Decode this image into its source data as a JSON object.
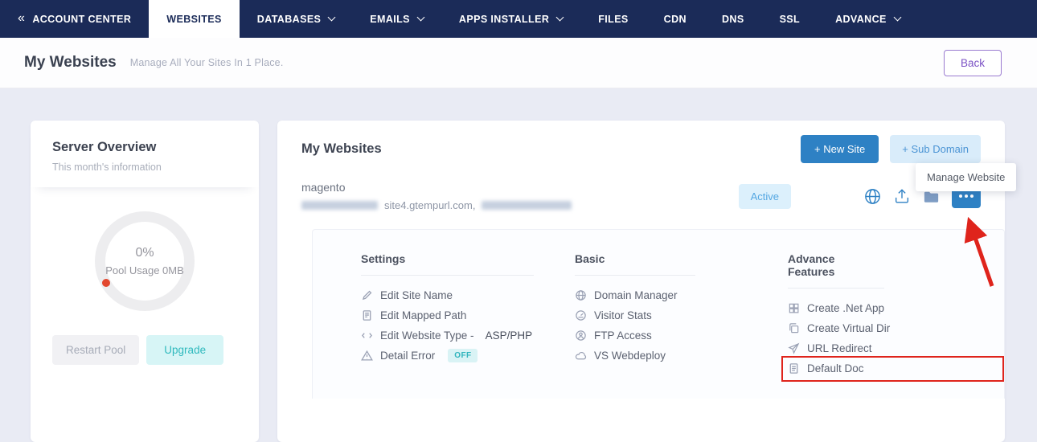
{
  "nav": {
    "back_icon": "«",
    "items": [
      {
        "label": "ACCOUNT CENTER",
        "dropdown": false,
        "active": false
      },
      {
        "label": "WEBSITES",
        "dropdown": false,
        "active": true
      },
      {
        "label": "DATABASES",
        "dropdown": true,
        "active": false
      },
      {
        "label": "EMAILS",
        "dropdown": true,
        "active": false
      },
      {
        "label": "APPS INSTALLER",
        "dropdown": true,
        "active": false
      },
      {
        "label": "FILES",
        "dropdown": false,
        "active": false
      },
      {
        "label": "CDN",
        "dropdown": false,
        "active": false
      },
      {
        "label": "DNS",
        "dropdown": false,
        "active": false
      },
      {
        "label": "SSL",
        "dropdown": false,
        "active": false
      },
      {
        "label": "ADVANCE",
        "dropdown": true,
        "active": false
      }
    ]
  },
  "header": {
    "title": "My Websites",
    "subtitle": "Manage All Your Sites In 1 Place.",
    "back_button": "Back"
  },
  "server_overview": {
    "title": "Server Overview",
    "subtitle": "This month's information",
    "gauge_value": "0%",
    "gauge_label": "Pool Usage 0MB",
    "restart_button": "Restart Pool",
    "upgrade_button": "Upgrade"
  },
  "websites": {
    "title": "My Websites",
    "new_site_button": "+ New Site",
    "sub_domain_button": "+ Sub Domain",
    "tooltip": "Manage Website",
    "site": {
      "name": "magento",
      "domain_visible": "site4.gtempurl.com,",
      "status": "Active"
    },
    "menu": {
      "settings": {
        "title": "Settings",
        "items": [
          {
            "label": "Edit Site Name",
            "icon": "edit-icon"
          },
          {
            "label": "Edit Mapped Path",
            "icon": "document-icon"
          },
          {
            "label": "Edit Website Type -",
            "value": "ASP/PHP",
            "icon": "arrows-icon"
          },
          {
            "label": "Detail Error",
            "badge": "OFF",
            "icon": "warning-icon"
          }
        ]
      },
      "basic": {
        "title": "Basic",
        "items": [
          {
            "label": "Domain Manager",
            "icon": "globe-icon"
          },
          {
            "label": "Visitor Stats",
            "icon": "stats-icon"
          },
          {
            "label": "FTP Access",
            "icon": "user-icon"
          },
          {
            "label": "VS Webdeploy",
            "icon": "cloud-icon"
          }
        ]
      },
      "advance": {
        "title": "Advance Features",
        "items": [
          {
            "label": "Create .Net App",
            "icon": "grid-icon"
          },
          {
            "label": "Create Virtual Dir",
            "icon": "copy-icon"
          },
          {
            "label": "URL Redirect",
            "icon": "send-icon"
          },
          {
            "label": "Default Doc",
            "icon": "doc-icon",
            "highlighted": true
          }
        ]
      }
    }
  },
  "colors": {
    "nav_navy": "#1b2b58",
    "primary_blue": "#2e81c4",
    "light_blue_bg": "#d9ecfa",
    "active_badge_bg": "#dcf0fc",
    "teal": "#2eb9bd",
    "teal_bg": "#d7f5f6",
    "purple": "#7c53c5",
    "annotation_red": "#df241c",
    "gauge_dot_red": "#e2472e",
    "page_bg": "#e9ebf4"
  }
}
